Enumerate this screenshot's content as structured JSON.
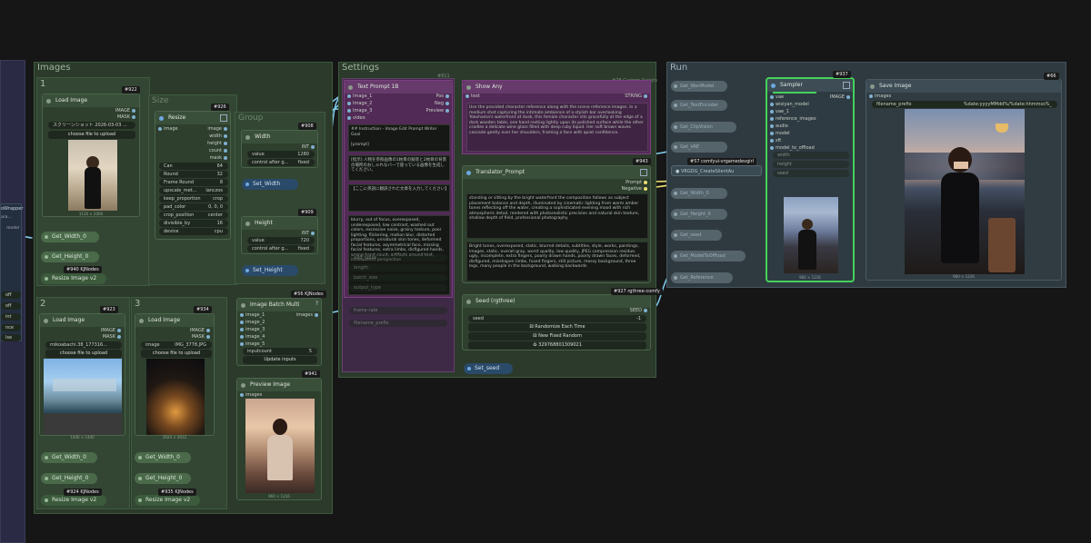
{
  "groups": {
    "images": "Images",
    "settings": "Settings",
    "run": "Run",
    "size": "Size",
    "group": "Group"
  },
  "subgroups": [
    "1",
    "2",
    "3"
  ],
  "load1": {
    "badge": "#922",
    "title": "Load Image",
    "out_image": "IMAGE",
    "out_mask": "MASK",
    "file": "スクリーンショット 2026-03-03 ...",
    "upload": "choose file to upload",
    "dim": "1126 × 2000"
  },
  "load2": {
    "badge": "#923",
    "title": "Load Image",
    "out_image": "IMAGE",
    "out_mask": "MASK",
    "file": "mikoabachi.38_177316...",
    "upload": "choose file to upload",
    "dim": "1440 × 1440"
  },
  "load3": {
    "badge": "#934",
    "title": "Load Image",
    "out_image": "IMAGE",
    "out_mask": "MASK",
    "file": "IMG_3778.JPG",
    "upload": "choose file to upload",
    "dim": "3024 × 4032",
    "image_label": "image"
  },
  "resize": {
    "badge": "#926",
    "title": "Resize",
    "in_image": "image",
    "outputs": [
      "image",
      "width",
      "height",
      "count",
      "mask"
    ],
    "widgets": [
      [
        "Can",
        "64"
      ],
      [
        "Round",
        "32"
      ],
      [
        "Frame Round",
        "8"
      ],
      [
        "upscale_met...",
        "lanczos"
      ],
      [
        "keep_proportion",
        "crop"
      ],
      [
        "pad_color",
        "0, 0, 0"
      ],
      [
        "crop_position",
        "center"
      ],
      [
        "divisible_by",
        "16"
      ],
      [
        "device",
        "cpu"
      ]
    ]
  },
  "width_node": {
    "badge": "#908",
    "title": "Width",
    "out": "INT",
    "value_label": "value",
    "value": "1280",
    "ctrl_label": "control after g...",
    "ctrl": "fixed",
    "set": "Set_Width"
  },
  "height_node": {
    "badge": "#909",
    "title": "Height",
    "out": "INT",
    "value_label": "value",
    "value": "720",
    "ctrl_label": "control after g...",
    "ctrl": "fixed",
    "set": "Set_Height"
  },
  "resize_v2": {
    "label": "Resize Image v2",
    "badges": [
      "#940 KJNodes",
      "#924 KJNodes",
      "#935 KJNodes"
    ]
  },
  "gets": [
    "Get_Width_0",
    "Get_Height_0"
  ],
  "batch": {
    "badge": "#56 KJNodes",
    "title": "Image Batch Multi",
    "inputs": [
      "image_1",
      "image_2",
      "image_3",
      "image_4",
      "image_5"
    ],
    "out": "images",
    "count_label": "inputcount",
    "count": "5",
    "update": "Update inputs",
    "help": "?"
  },
  "preview": {
    "badge": "#941",
    "title": "Preview Image",
    "in": "images",
    "dim": "960 × 1216"
  },
  "settings": {
    "header_badge": "#811",
    "clip": {
      "title": "Text Prompt 1B",
      "inputs": [
        "Image_1",
        "Image_2",
        "Image_3",
        "video"
      ],
      "outputs": [
        "Pos",
        "Neg",
        "Preview"
      ],
      "text1": "## Instruction - Image Edit Prompt Writer\nGoal\n\n[prompt]\n\nreference images",
      "text2": "[指示] 人物を参照画像の1枚目の服装と2枚目の背景の場所のおしゃれなバーで座っている画像を生成してください。",
      "text3": "【ここに英語に翻訳された文章を入力してください】",
      "text4": "blurry, out of focus, overexposed, underexposed, low contrast, washed out colors, excessive noise, grainy texture, poor lighting, flickering, motion blur, distorted proportions, unnatural skin tones, deformed facial features, asymmetrical face, missing facial features, extra limbs, disfigured hands, wrong hand count, artifacts around text, inconsistent perspective"
    },
    "showtext": {
      "title": "Show Any",
      "in": "text",
      "out": "STRING",
      "text": "Use the provided character reference along with the scene reference images. In a medium shot capturing the intimate ambience of a stylish bar overlooking Yokohama's waterfront at dusk, this female character sits gracefully at the edge of a dark wooden table, one hand resting lightly upon its polished surface while the other cradles a delicate wine glass filled with deep ruby liquid. Her soft brown waves cascade gently over her shoulders, framing a face with quiet confidence."
    },
    "header_text": "#78 Custom Scripts",
    "translator": {
      "badge": "#943",
      "title": "Translator_Prompt",
      "outputs": [
        "Prompt",
        "Negative"
      ],
      "text1": "standing or sitting by the bright waterfront the composition follows as subject placement balance and depth, illuminated by cinematic lighting from warm amber tones reflecting off the water, creating a sophisticated evening mood with rich atmospheric detail, rendered with photorealistic precision and natural skin texture, shallow depth of field, professional photography",
      "text2": "Bright tones, overexposed, static, blurred details, subtitles, style, works, paintings, images, static, overall gray, worst quality, low quality, JPEG compression residue, ugly, incomplete, extra fingers, poorly drawn hands, poorly drawn faces, deformed, disfigured, misshapen limbs, fused fingers, still picture, messy background, three legs, many people in the background, walking backwards"
    },
    "seed": {
      "badge": "#927 rgthree-comfy",
      "title": "Seed (rgthree)",
      "out": "SEED",
      "seed_label": "seed",
      "seed_val": "-1",
      "btn1": "Randomize Each Time",
      "btn2": "New Fixed Random",
      "btn3": "329768801309021",
      "set": "Set_seed"
    },
    "ghost_rows": [
      "add_noise",
      "length",
      "batch_size",
      "output_type",
      "frame rate",
      "filename_prefix"
    ]
  },
  "run": {
    "sampler": {
      "badge": "#937",
      "title": "Sampler",
      "inputs": [
        "vae",
        "wisiyan_model",
        "vae_1",
        "reference_images",
        "audio",
        "model",
        "sft",
        "model_to_offload"
      ],
      "out": "IMAGE",
      "widgets": [
        "width",
        "height",
        "seed"
      ],
      "dim": "960 × 1216"
    },
    "save": {
      "badge": "#66",
      "title": "Save Image",
      "in": "images",
      "prefix_label": "filename_prefix",
      "prefix": "%date:yyyyMMdd%/%date:hhmmss%_",
      "dim": "960 × 1216"
    },
    "vrgdg": {
      "badge": "#57 comfyui-vrgamedevgirl",
      "title": "VRGDG_CreateSilentAu"
    },
    "gets": [
      "Get_WanModel",
      "Get_TextEncoder",
      "Get_ClipVision",
      "Get_VAE",
      "Get_Width_0",
      "Get_Height_0",
      "Get_seed",
      "Get_ModelToOffload",
      "Get_Reference"
    ]
  },
  "left_panel": {
    "label": "oWrapper",
    "sub": "ara...",
    "out": "model",
    "rows": [
      "off",
      "off",
      "int",
      "nce",
      "lse",
      "lse"
    ]
  }
}
